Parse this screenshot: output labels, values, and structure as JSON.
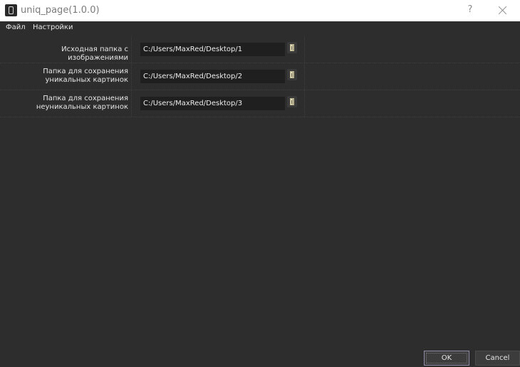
{
  "window": {
    "title": "uniq_page(1.0.0)",
    "help_label": "?",
    "background": "#2d2d2d",
    "titlebar_color": "#ffffff"
  },
  "menu": {
    "items": [
      {
        "label": "Файл"
      },
      {
        "label": "Настройки"
      }
    ]
  },
  "form": {
    "rows": [
      {
        "label": "Исходная папка с изображениями",
        "path": "C:/Users/MaxRed/Desktop/1",
        "button_icon": "folder-icon"
      },
      {
        "label": "Папка для сохранения уникальных картинок",
        "path": "C:/Users/MaxRed/Desktop/2",
        "button_icon": "folder-icon"
      },
      {
        "label": "Папка для сохранения неуникальных картинок",
        "path": "C:/Users/MaxRed/Desktop/3",
        "button_icon": "folder-icon"
      }
    ]
  },
  "buttons": {
    "ok_label": "OK",
    "cancel_label": "Cancel"
  }
}
